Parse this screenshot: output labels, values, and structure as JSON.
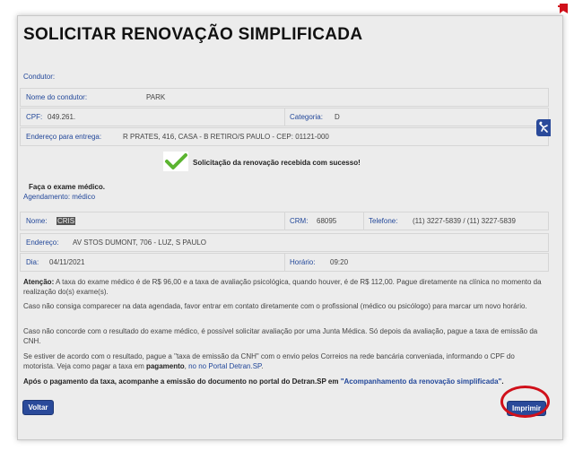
{
  "page": {
    "title": "SOLICITAR RENOVAÇÃO SIMPLIFICADA"
  },
  "condutor_section": {
    "heading": "Condutor:",
    "nome_label": "Nome do condutor:",
    "nome_value": "PARK",
    "cpf_label": "CPF:",
    "cpf_value": "049.261.",
    "categoria_label": "Categoria:",
    "categoria_value": "D",
    "endereco_label": "Endereço para entrega:",
    "endereco_value": "R PRATES, 416, CASA - B RETIRO/S PAULO - CEP: 01121-000"
  },
  "success": {
    "message": "Solicitação da renovação recebida com sucesso!",
    "icon": "checkmark-icon",
    "color": "#5cb531"
  },
  "exame": {
    "instruction": "Faça o exame médico.",
    "agendamento_label": "Agendamento: médico",
    "nome_label": "Nome:",
    "nome_value": "CRIS",
    "crm_label": "CRM:",
    "crm_value": "68095",
    "telefone_label": "Telefone:",
    "telefone_value": "(11) 3227-5839 / (11) 3227-5839",
    "endereco_label": "Endereço:",
    "endereco_value": "AV STOS DUMONT, 706 - LUZ, S PAULO",
    "dia_label": "Dia:",
    "dia_value": "04/11/2021",
    "horario_label": "Horário:",
    "horario_value": "09:20"
  },
  "info": {
    "p1_bold": "Atenção:",
    "p1_text": " A taxa do exame médico é de R$ 96,00 e a taxa de avaliação psicológica, quando houver, é de R$ 112,00. Pague diretamente na clínica no momento da realização do(s) exame(s).",
    "p2": "Caso não consiga comparecer na data agendada, favor entrar em contato diretamente com o profissional (médico ou psicólogo) para marcar um novo horário.",
    "p3": "Caso não concorde com o resultado do exame médico, é possível solicitar avaliação por uma Junta Médica. Só depois da avaliação, pague a taxa de emissão da CNH.",
    "p4_text": "Se estiver de acordo com o resultado, pague a \"taxa de emissão da CNH\" com o envio pelos Correios na rede bancária conveniada, informando o CPF do motorista. Veja como pagar a taxa em ",
    "p4_bold": "pagamento",
    "p4_mid": ", ",
    "p4_link": "no no Portal Detran.SP",
    "p4_end": ".",
    "p5_bold": "Após o pagamento da taxa, acompanhe a emissão do documento no portal do Detran.SP em ",
    "p5_link": "\"Acompanhamento da renovação simplificada\"",
    "p5_end": "."
  },
  "buttons": {
    "voltar": "Voltar",
    "imprimir": "Imprimir"
  },
  "colors": {
    "accent": "#2a4a9a",
    "highlight_circle": "#d0101a"
  }
}
